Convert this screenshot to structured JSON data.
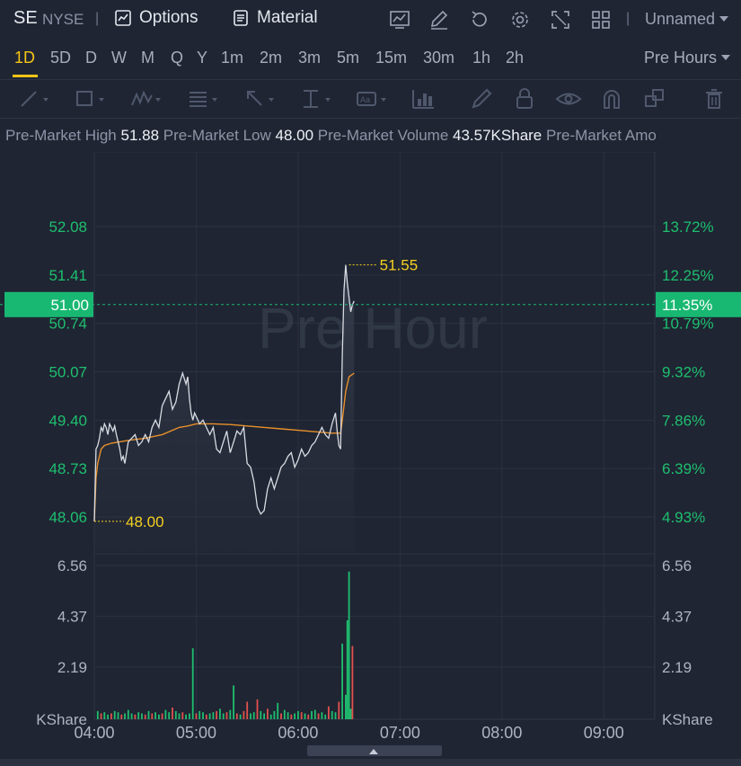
{
  "header": {
    "symbol": "SE",
    "exchange": "NYSE",
    "separator": "|",
    "options_label": "Options",
    "material_label": "Material",
    "layout_name": "Unnamed",
    "icons": [
      "chart-icon",
      "edit-icon",
      "refresh-icon",
      "gear-icon",
      "expand-icon",
      "grid-icon"
    ]
  },
  "periods": {
    "items": [
      "1D",
      "5D",
      "D",
      "W",
      "M",
      "Q",
      "Y",
      "1m",
      "2m",
      "3m",
      "5m",
      "15m",
      "30m",
      "1h",
      "2h"
    ],
    "active": "1D",
    "session_label": "Pre Hours"
  },
  "stats": {
    "high_label": "Pre-Market High",
    "high_value": "51.88",
    "low_label": "Pre-Market Low",
    "low_value": "48.00",
    "volume_label": "Pre-Market Volume",
    "volume_value": "43.57KShare",
    "amount_label": "Pre-Market Amo"
  },
  "chart_data": {
    "type": "line",
    "watermark": "Pre Hour",
    "price_ticks": [
      "52.08",
      "51.41",
      "50.74",
      "50.07",
      "49.40",
      "48.73",
      "48.06"
    ],
    "price_tick_values": [
      52.08,
      51.41,
      50.74,
      50.07,
      49.4,
      48.73,
      48.06
    ],
    "percent_ticks": [
      "13.72%",
      "12.25%",
      "10.79%",
      "9.32%",
      "7.86%",
      "6.39%",
      "4.93%"
    ],
    "volume_ticks": [
      "6.56",
      "4.37",
      "2.19"
    ],
    "volume_tick_values": [
      6.56,
      4.37,
      2.19
    ],
    "volume_unit": "KShare",
    "x_ticks": [
      "04:00",
      "05:00",
      "06:00",
      "07:00",
      "08:00",
      "09:00"
    ],
    "x_tick_minutes": [
      0,
      60,
      120,
      180,
      240,
      300
    ],
    "x_range_minutes": [
      0,
      330
    ],
    "price_range": [
      47.7,
      53.2
    ],
    "volume_range": [
      0,
      7.6
    ],
    "current_price": "51.00",
    "current_percent": "11.35%",
    "current_price_value": 51.0,
    "high_marker": {
      "label": "51.55",
      "minute": 150,
      "value": 51.55
    },
    "low_marker": {
      "label": "48.00",
      "minute": 0,
      "value": 48.0
    },
    "colors": {
      "price": "#d9dce3",
      "avg": "#e8902b",
      "up": "#1fbf6f",
      "down": "#e0524c",
      "label": "#f5d020",
      "axis_green": "#1fbf6f",
      "grid": "#2b3243",
      "current_bg": "#19b872"
    },
    "series": [
      {
        "name": "price",
        "x": [
          0,
          1,
          2,
          3,
          4,
          5,
          6,
          7,
          8,
          9,
          10,
          11,
          12,
          13,
          14,
          15,
          16,
          17,
          18,
          19,
          20,
          22,
          24,
          26,
          28,
          30,
          32,
          34,
          36,
          38,
          40,
          42,
          44,
          46,
          48,
          50,
          52,
          54,
          55,
          56,
          57,
          58,
          59,
          60,
          62,
          64,
          66,
          68,
          70,
          72,
          74,
          76,
          78,
          80,
          82,
          84,
          86,
          88,
          90,
          92,
          94,
          96,
          98,
          100,
          102,
          104,
          106,
          108,
          110,
          112,
          114,
          116,
          118,
          120,
          122,
          124,
          126,
          128,
          130,
          132,
          134,
          136,
          138,
          140,
          142,
          143,
          144,
          145,
          146,
          147,
          148,
          149,
          150,
          151,
          152,
          153
        ],
        "y": [
          48.0,
          49.0,
          49.05,
          49.15,
          49.3,
          49.25,
          49.35,
          49.3,
          49.2,
          49.35,
          49.3,
          49.25,
          49.32,
          49.2,
          49.1,
          49.0,
          48.85,
          48.9,
          48.8,
          48.95,
          49.1,
          49.15,
          49.2,
          49.05,
          49.1,
          49.2,
          49.1,
          49.3,
          49.4,
          49.3,
          49.6,
          49.7,
          49.8,
          49.55,
          49.65,
          49.9,
          50.05,
          49.9,
          50.0,
          49.7,
          49.5,
          49.4,
          49.5,
          49.45,
          49.35,
          49.4,
          49.3,
          49.2,
          49.3,
          49.0,
          48.95,
          49.1,
          49.25,
          48.95,
          49.1,
          49.25,
          49.2,
          49.3,
          48.8,
          48.75,
          48.55,
          48.2,
          48.1,
          48.15,
          48.45,
          48.6,
          48.45,
          48.6,
          48.75,
          48.8,
          48.9,
          48.95,
          48.75,
          48.85,
          49.0,
          48.9,
          48.95,
          49.05,
          49.1,
          49.2,
          49.3,
          49.2,
          49.15,
          49.35,
          49.5,
          49.25,
          49.05,
          49.0,
          50.3,
          51.2,
          51.55,
          51.3,
          51.1,
          50.9,
          51.0,
          51.05
        ]
      },
      {
        "name": "average",
        "x": [
          0,
          1,
          2,
          4,
          6,
          10,
          15,
          20,
          30,
          40,
          50,
          55,
          60,
          70,
          80,
          90,
          100,
          110,
          120,
          130,
          140,
          145,
          146,
          147,
          148,
          150,
          153
        ],
        "y": [
          48.0,
          48.6,
          48.8,
          49.0,
          49.05,
          49.08,
          49.1,
          49.12,
          49.15,
          49.2,
          49.3,
          49.32,
          49.35,
          49.35,
          49.34,
          49.32,
          49.3,
          49.28,
          49.26,
          49.24,
          49.22,
          49.22,
          49.4,
          49.6,
          49.8,
          50.0,
          50.05
        ]
      },
      {
        "name": "volume",
        "x": [
          2,
          4,
          6,
          8,
          10,
          12,
          14,
          16,
          18,
          20,
          22,
          24,
          26,
          28,
          30,
          32,
          34,
          36,
          38,
          40,
          42,
          44,
          46,
          48,
          50,
          52,
          54,
          56,
          58,
          60,
          62,
          64,
          66,
          68,
          70,
          72,
          74,
          76,
          78,
          80,
          82,
          84,
          86,
          88,
          90,
          92,
          94,
          96,
          98,
          100,
          102,
          104,
          106,
          108,
          110,
          112,
          114,
          116,
          118,
          120,
          122,
          124,
          126,
          128,
          130,
          132,
          134,
          136,
          138,
          140,
          142,
          144,
          146,
          148,
          149,
          150,
          151,
          152
        ],
        "y": [
          0.3,
          0.2,
          0.25,
          0.15,
          0.2,
          0.3,
          0.25,
          0.15,
          0.2,
          0.35,
          0.2,
          0.15,
          0.25,
          0.2,
          0.15,
          0.3,
          0.2,
          0.25,
          0.15,
          0.2,
          0.35,
          0.25,
          0.45,
          0.3,
          0.2,
          0.25,
          0.15,
          0.2,
          3.0,
          0.2,
          0.3,
          0.25,
          0.15,
          0.2,
          0.25,
          0.3,
          0.4,
          0.2,
          0.25,
          0.35,
          1.4,
          0.2,
          0.15,
          0.3,
          0.7,
          0.2,
          0.25,
          0.8,
          0.3,
          0.2,
          0.4,
          0.15,
          0.3,
          0.65,
          0.2,
          0.35,
          0.25,
          0.15,
          0.2,
          0.3,
          0.25,
          0.2,
          0.15,
          0.3,
          0.35,
          0.2,
          0.25,
          0.15,
          0.5,
          0.3,
          0.25,
          0.7,
          3.2,
          1.0,
          4.2,
          6.3,
          0.4,
          3.1
        ],
        "dir": [
          "u",
          "d",
          "u",
          "u",
          "d",
          "u",
          "u",
          "d",
          "u",
          "u",
          "u",
          "d",
          "u",
          "u",
          "d",
          "u",
          "d",
          "u",
          "u",
          "d",
          "u",
          "u",
          "d",
          "u",
          "u",
          "d",
          "u",
          "u",
          "u",
          "d",
          "u",
          "u",
          "d",
          "u",
          "u",
          "d",
          "u",
          "u",
          "d",
          "u",
          "u",
          "d",
          "u",
          "d",
          "d",
          "u",
          "u",
          "d",
          "u",
          "u",
          "d",
          "u",
          "u",
          "u",
          "d",
          "u",
          "u",
          "d",
          "u",
          "u",
          "d",
          "u",
          "d",
          "u",
          "u",
          "d",
          "u",
          "u",
          "d",
          "u",
          "u",
          "d",
          "u",
          "u",
          "u",
          "u",
          "u",
          "d"
        ]
      }
    ]
  },
  "drawtools": [
    "line-tool-icon",
    "rectangle-tool-icon",
    "pattern-tool-icon",
    "fib-tool-icon",
    "arrow-tool-icon",
    "measure-tool-icon",
    "text-tool-icon",
    "indicator-tool-icon",
    "pen-icon",
    "lock-icon",
    "eye-icon",
    "magnet-icon",
    "layers-icon",
    "trash-icon"
  ]
}
